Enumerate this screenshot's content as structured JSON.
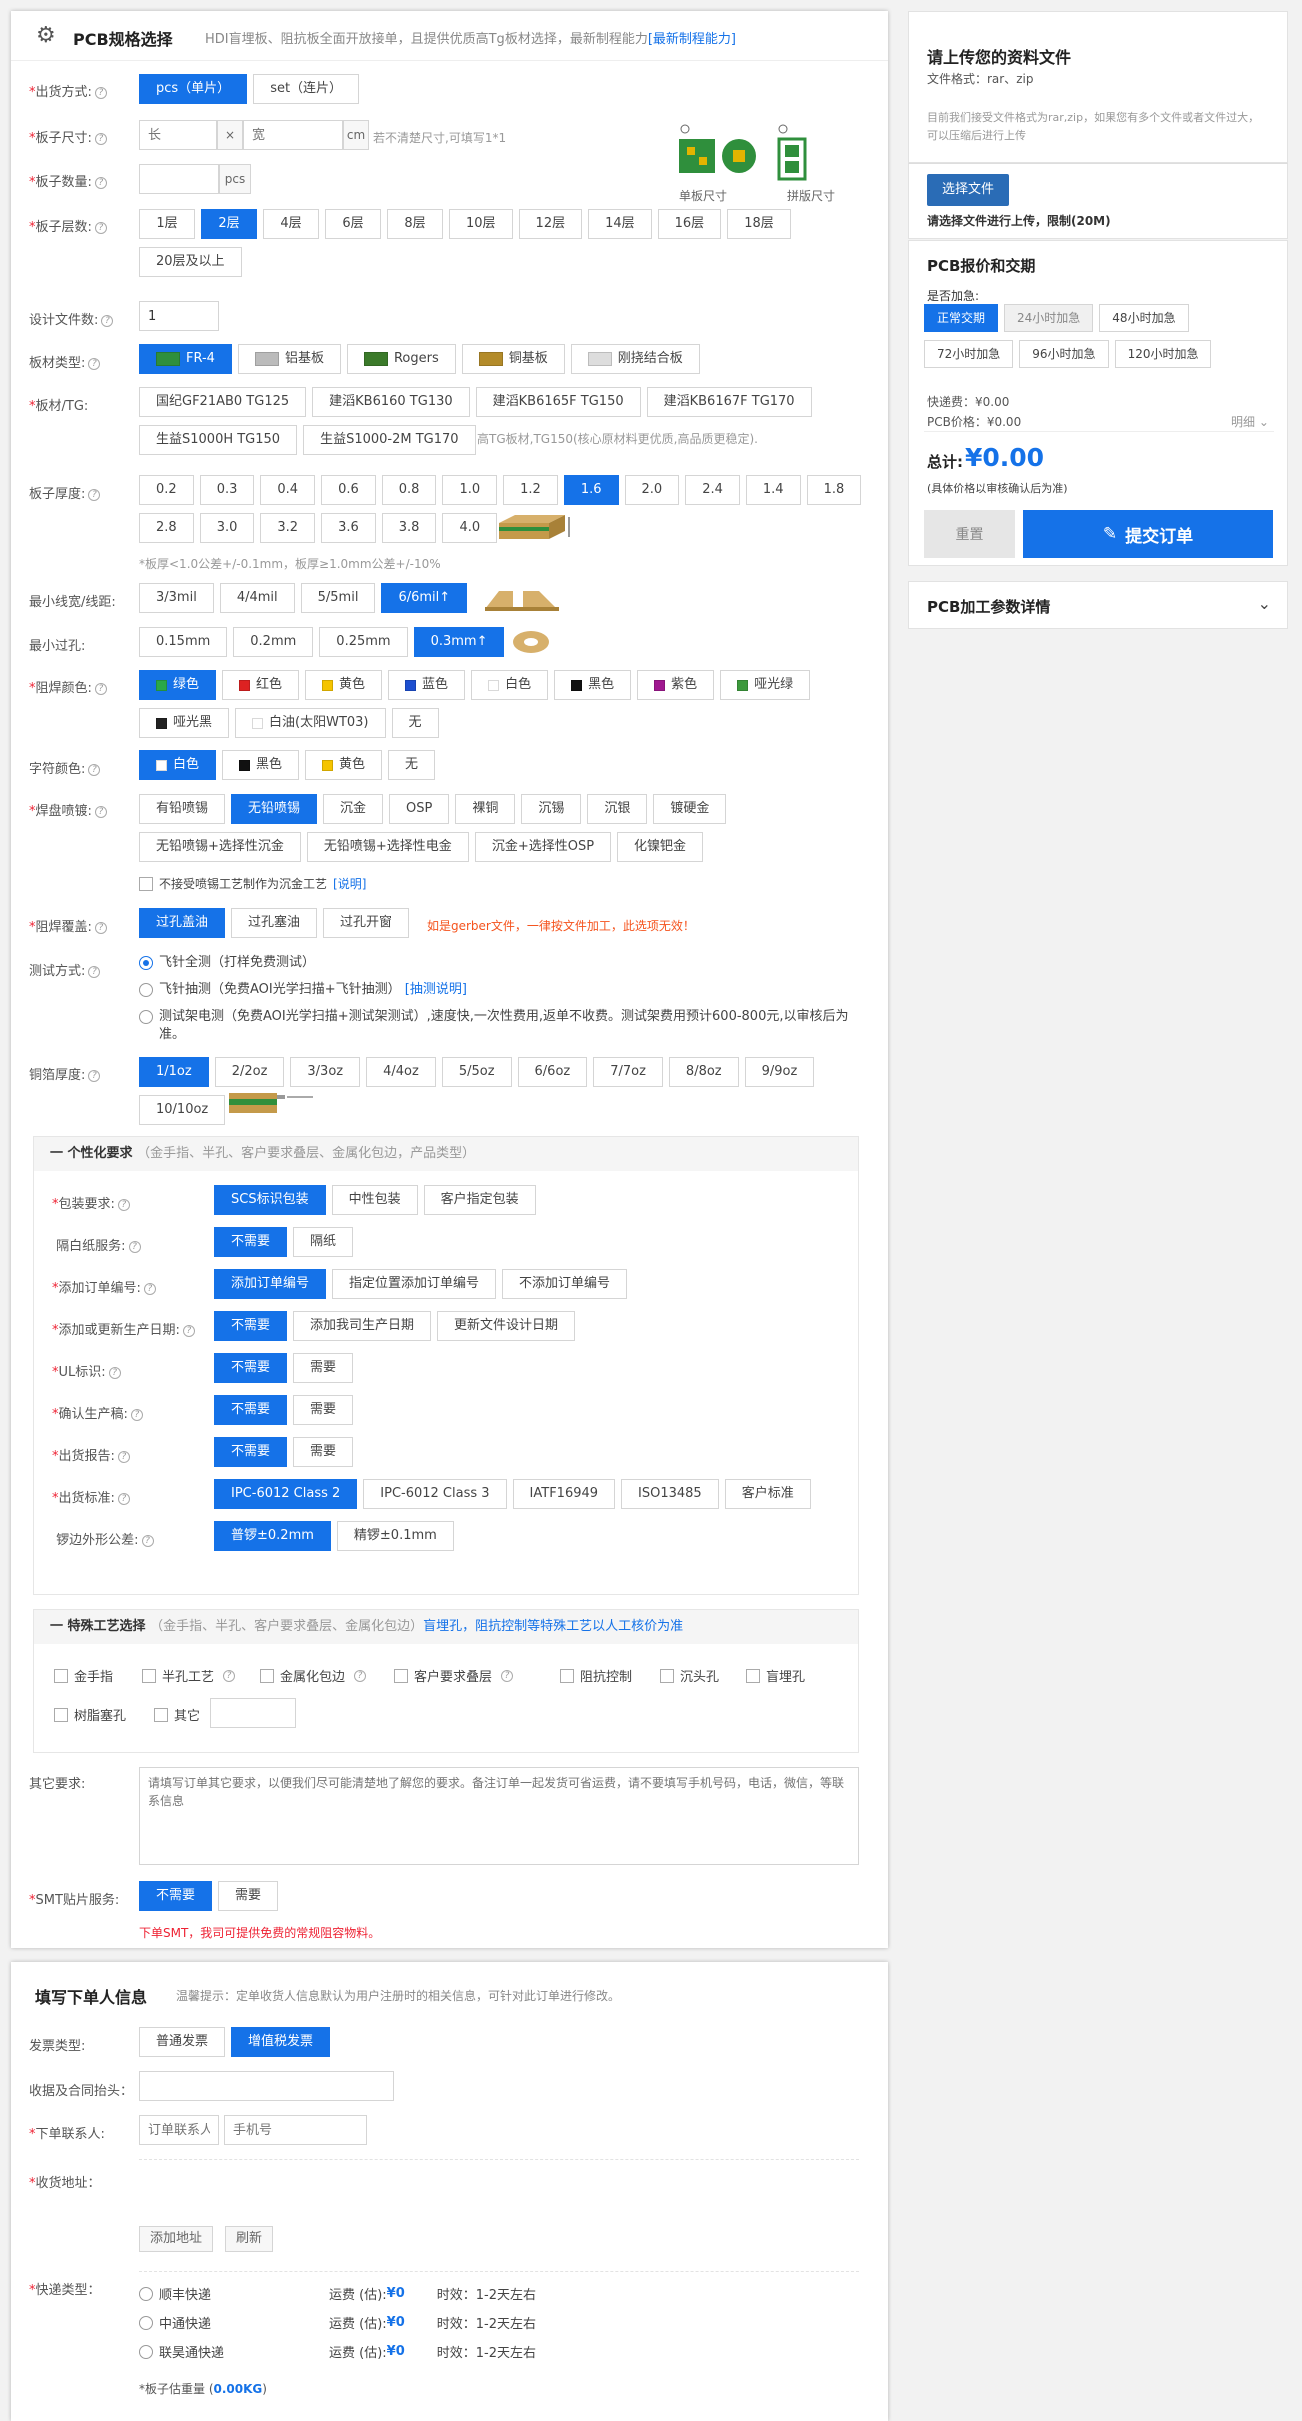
{
  "header": {
    "title": "PCB规格选择",
    "subtitle": "HDI盲埋板、阻抗板全面开放接单，且提供优质高Tg板材选择，最新制程能力",
    "subtitle_link": "[最新制程能力]"
  },
  "shipping_mode": {
    "label": "出货方式:",
    "options": [
      "pcs（单片）",
      "set（连片）"
    ],
    "selected": 0
  },
  "size": {
    "label": "板子尺寸:",
    "length_placeholder": "长",
    "x": "×",
    "width_placeholder": "宽",
    "unit": "cm",
    "hint": "若不清楚尺寸,可填写1*1",
    "img1": "单板尺寸",
    "img2": "拼版尺寸"
  },
  "qty": {
    "label": "板子数量:",
    "unit": "pcs"
  },
  "layers": {
    "label": "板子层数:",
    "options": [
      "1层",
      "2层",
      "4层",
      "6层",
      "8层",
      "10层",
      "12层",
      "14层",
      "16层",
      "18层",
      "20层及以上"
    ],
    "selected": 1
  },
  "design_files": {
    "label": "设计文件数:",
    "value": "1"
  },
  "board_type": {
    "label": "板材类型:",
    "options": [
      "FR-4",
      "铝基板",
      "Rogers",
      "铜基板",
      "刚挠结合板"
    ],
    "selected": 0
  },
  "material": {
    "label": "板材/TG:",
    "options": [
      "国纪GF21AB0 TG125",
      "建滔KB6160 TG130",
      "建滔KB6165F TG150",
      "建滔KB6167F TG170",
      "生益S1000H TG150",
      "生益S1000-2M TG170"
    ],
    "hint": "高TG板材,TG150(核心原材料更优质,高品质更稳定)."
  },
  "thickness": {
    "label": "板子厚度:",
    "options": [
      "0.2",
      "0.3",
      "0.4",
      "0.6",
      "0.8",
      "1.0",
      "1.2",
      "1.6",
      "2.0",
      "2.4",
      "1.4",
      "1.8",
      "2.8",
      "3.0",
      "3.2",
      "3.6",
      "3.8",
      "4.0"
    ],
    "selected": 7,
    "note": "*板厚<1.0公差+/-0.1mm，板厚≥1.0mm公差+/-10%"
  },
  "min_trace": {
    "label": "最小线宽/线距:",
    "options": [
      "3/3mil",
      "4/4mil",
      "5/5mil",
      "6/6mil↑"
    ],
    "selected": 3
  },
  "min_hole": {
    "label": "最小过孔:",
    "options": [
      "0.15mm",
      "0.2mm",
      "0.25mm",
      "0.3mm↑"
    ],
    "selected": 3
  },
  "soldermask": {
    "label": "阻焊颜色:",
    "options": [
      {
        "t": "绿色",
        "c": "#2aa84a"
      },
      {
        "t": "红色",
        "c": "#d22"
      },
      {
        "t": "黄色",
        "c": "#f5c400"
      },
      {
        "t": "蓝色",
        "c": "#1d4fd0"
      },
      {
        "t": "白色",
        "c": "#ffffff"
      },
      {
        "t": "黑色",
        "c": "#111111"
      },
      {
        "t": "紫色",
        "c": "#a01890"
      },
      {
        "t": "哑光绿",
        "c": "#3c9a3c"
      },
      {
        "t": "哑光黑",
        "c": "#222222"
      },
      {
        "t": "白油(太阳WT03)",
        "c": "#ffffff"
      },
      {
        "t": "无",
        "c": ""
      }
    ],
    "selected": 0
  },
  "silkscreen": {
    "label": "字符颜色:",
    "options": [
      {
        "t": "白色",
        "c": "#ffffff"
      },
      {
        "t": "黑色",
        "c": "#111111"
      },
      {
        "t": "黄色",
        "c": "#f5c400"
      },
      {
        "t": "无",
        "c": ""
      }
    ],
    "selected": 0
  },
  "surface": {
    "label": "焊盘喷镀:",
    "options": [
      "有铅喷锡",
      "无铅喷锡",
      "沉金",
      "OSP",
      "裸铜",
      "沉锡",
      "沉银",
      "镀硬金",
      "无铅喷锡+选择性沉金",
      "无铅喷锡+选择性电金",
      "沉金+选择性OSP",
      "化镍钯金"
    ],
    "selected": 1,
    "checkbox": "不接受喷锡工艺制作为沉金工艺",
    "checkbox_link": "[说明]"
  },
  "via": {
    "label": "阻焊覆盖:",
    "options": [
      "过孔盖油",
      "过孔塞油",
      "过孔开窗"
    ],
    "selected": 0,
    "warn": "如是gerber文件，一律按文件加工，此选项无效！"
  },
  "test": {
    "label": "测试方式:",
    "options": [
      "飞针全测（打样免费测试）",
      "飞针抽测（免费AOI光学扫描+飞针抽测）",
      "测试架电测（免费AOI光学扫描+测试架测试）,速度快,一次性费用,返单不收费。测试架费用预计600-800元,以审核后为准。"
    ],
    "link": "[抽测说明]",
    "selected": 0
  },
  "copper": {
    "label": "铜箔厚度:",
    "options": [
      "1/1oz",
      "2/2oz",
      "3/3oz",
      "4/4oz",
      "5/5oz",
      "6/6oz",
      "7/7oz",
      "8/8oz",
      "9/9oz",
      "10/10oz"
    ],
    "selected": 0
  },
  "personal": {
    "title": "个性化要求",
    "sub": "（金手指、半孔、客户要求叠层、金属化包边，产品类型）",
    "rows": [
      {
        "label": "包装要求:",
        "options": [
          "SCS标识包装",
          "中性包装",
          "客户指定包装"
        ],
        "req": true
      },
      {
        "label": "隔白纸服务:",
        "options": [
          "不需要",
          "隔纸"
        ],
        "req": false
      },
      {
        "label": "添加订单编号:",
        "options": [
          "添加订单编号",
          "指定位置添加订单编号",
          "不添加订单编号"
        ],
        "req": true
      },
      {
        "label": "添加或更新生产日期:",
        "options": [
          "不需要",
          "添加我司生产日期",
          "更新文件设计日期"
        ],
        "req": true
      },
      {
        "label": "UL标识:",
        "options": [
          "不需要",
          "需要"
        ],
        "req": true
      },
      {
        "label": "确认生产稿:",
        "options": [
          "不需要",
          "需要"
        ],
        "req": true
      },
      {
        "label": "出货报告:",
        "options": [
          "不需要",
          "需要"
        ],
        "req": true
      },
      {
        "label": "出货标准:",
        "options": [
          "IPC-6012 Class 2",
          "IPC-6012 Class 3",
          "IATF16949",
          "ISO13485",
          "客户标准"
        ],
        "req": true
      },
      {
        "label": "锣边外形公差:",
        "options": [
          "普锣±0.2mm",
          "精锣±0.1mm"
        ],
        "req": false
      }
    ]
  },
  "special": {
    "title": "特殊工艺选择",
    "sub": "（金手指、半孔、客户要求叠层、金属化包边）",
    "link": "盲埋孔，阻抗控制等特殊工艺以人工核价为准",
    "items": [
      "金手指",
      "半孔工艺",
      "金属化包边",
      "客户要求叠层",
      "阻抗控制",
      "沉头孔",
      "盲埋孔",
      "树脂塞孔",
      "其它"
    ]
  },
  "other": {
    "label": "其它要求:",
    "placeholder": "请填写订单其它要求，以便我们尽可能清楚地了解您的要求。备注订单一起发货可省运费，请不要填写手机号码，电话，微信，等联系信息"
  },
  "smt": {
    "label": "SMT贴片服务:",
    "options": [
      "不需要",
      "需要"
    ],
    "selected": 0,
    "note": "下单SMT，我司可提供免费的常规阻容物料。"
  },
  "order": {
    "title": "填写下单人信息",
    "tip": "温馨提示：定单收货人信息默认为用户注册时的相关信息，可针对此订单进行修改。",
    "invoice_label": "发票类型:",
    "invoice_options": [
      "普通发票",
      "增值税发票"
    ],
    "invoice_selected": 1,
    "contract_label": "收据及合同抬头：",
    "contact_label": "下单联系人:",
    "contact_ph": "订单联系人",
    "phone_ph": "手机号",
    "addr_label": "收货地址：",
    "add_addr": "添加地址",
    "refresh": "刷新",
    "express_label": "快递类型：",
    "express": [
      {
        "n": "顺丰快递",
        "fee": "运费 (估):",
        "v": "¥0",
        "time": "时效：1-2天左右"
      },
      {
        "n": "中通快递",
        "fee": "运费 (估):",
        "v": "¥0",
        "time": "时效：1-2天左右"
      },
      {
        "n": "联昊通快递",
        "fee": "运费 (估):",
        "v": "¥0",
        "time": "时效：1-2天左右"
      }
    ],
    "weight_label": "*板子估重量 (",
    "weight": "0.00KG",
    "weight_end": ")"
  },
  "upload": {
    "title": "请上传您的资料文件",
    "formats": "文件格式：rar、zip",
    "desc": "目前我们接受文件格式为rar,zip，如果您有多个文件或者文件过大，可以压缩后进行上传",
    "btn": "选择文件",
    "hint": "请选择文件进行上传，限制(20M)"
  },
  "quote": {
    "title": "PCB报价和交期",
    "urgent_label": "是否加急:",
    "urgent": [
      "正常交期",
      "24小时加急",
      "48小时加急",
      "72小时加急",
      "96小时加急",
      "120小时加急"
    ],
    "urgent_selected": 0,
    "express": "快递费：¥0.00",
    "pcb": "PCB价格：¥0.00",
    "detail": "明细",
    "total_label": "总计:",
    "total": "¥0.00",
    "note": "(具体价格以审核确认后为准)",
    "reset": "重置",
    "submit": "提交订单"
  },
  "params": {
    "title": "PCB加工参数详情"
  }
}
